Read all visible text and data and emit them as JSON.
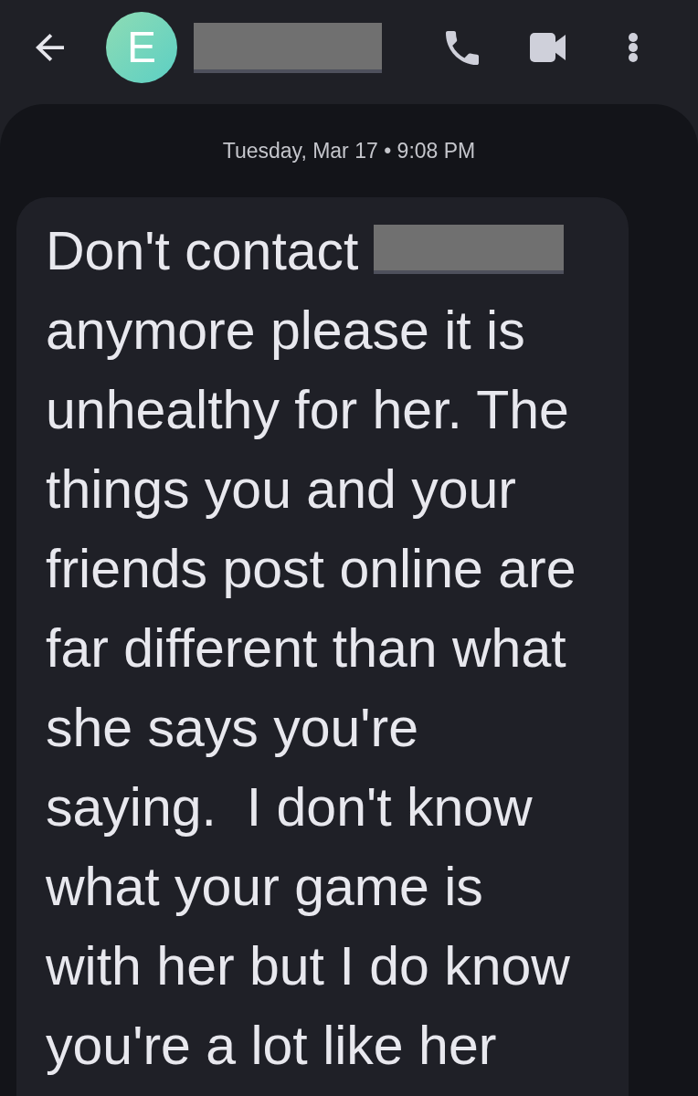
{
  "app_bar": {
    "avatar": {
      "letter": "E"
    },
    "contact_name": {
      "redacted": true
    }
  },
  "conversation": {
    "timestamp": "Tuesday, Mar 17 • 9:08 PM",
    "messages": [
      {
        "kind": "received",
        "parts": [
          {
            "kind": "text",
            "text": "Don't contact"
          },
          {
            "kind": "redaction"
          },
          {
            "kind": "text",
            "text": "anymore please it is unhealthy for her. The things you and your friends post online are far different than what she says you're saying.  I don't know what your game is with her but I do know you're a lot like her"
          }
        ]
      }
    ]
  }
}
